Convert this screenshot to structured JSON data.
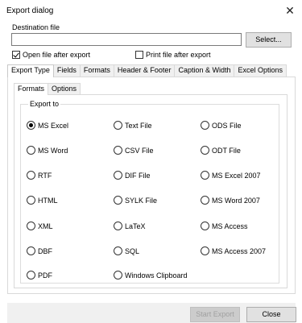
{
  "window": {
    "title": "Export dialog"
  },
  "destination": {
    "label": "Destination file",
    "value": "",
    "select_label": "Select..."
  },
  "options": {
    "open_after": {
      "label": "Open file after export",
      "checked": true
    },
    "print_after": {
      "label": "Print file after export",
      "checked": false
    }
  },
  "tabs": [
    {
      "label": "Export Type",
      "active": true
    },
    {
      "label": "Fields"
    },
    {
      "label": "Formats"
    },
    {
      "label": "Header & Footer"
    },
    {
      "label": "Caption & Width"
    },
    {
      "label": "Excel Options"
    }
  ],
  "subtabs": [
    {
      "label": "Formats",
      "active": true
    },
    {
      "label": "Options"
    }
  ],
  "export_to": {
    "legend": "Export to",
    "selected": "MS Excel",
    "options": [
      "MS Excel",
      "Text File",
      "ODS File",
      "MS Word",
      "CSV File",
      "ODT File",
      "RTF",
      "DIF File",
      "MS Excel 2007",
      "HTML",
      "SYLK File",
      "MS Word 2007",
      "XML",
      "LaTeX",
      "MS Access",
      "DBF",
      "SQL",
      "MS Access 2007",
      "PDF",
      "Windows Clipboard"
    ]
  },
  "footer": {
    "start_label": "Start Export",
    "start_enabled": false,
    "close_label": "Close"
  }
}
